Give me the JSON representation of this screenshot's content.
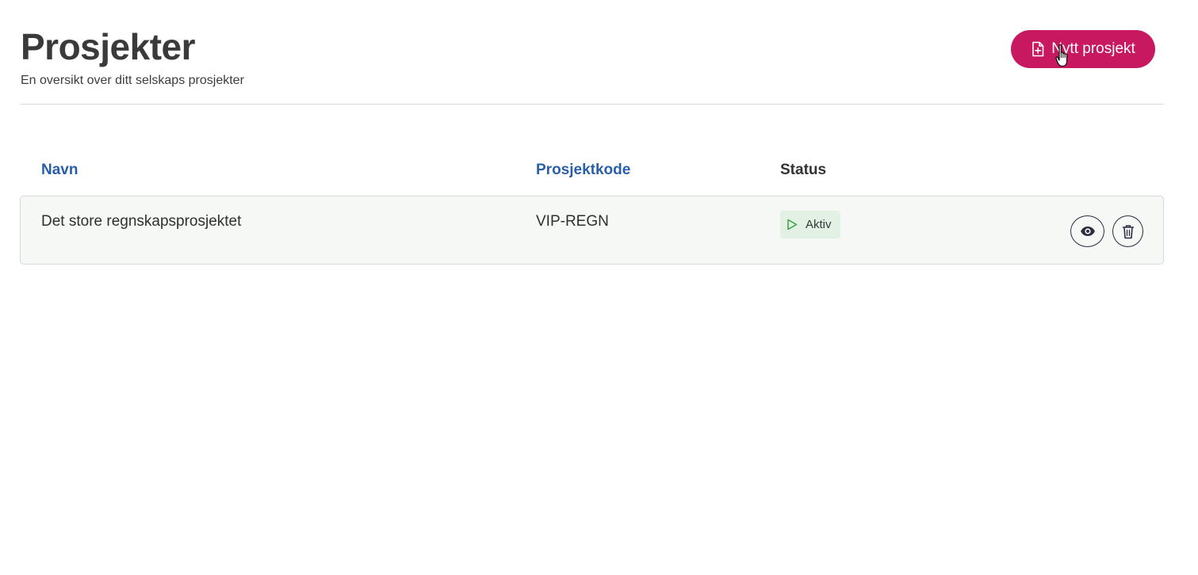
{
  "header": {
    "title": "Prosjekter",
    "subtitle": "En oversikt over ditt selskaps prosjekter",
    "new_button_label": "Nytt prosjekt"
  },
  "table": {
    "columns": [
      {
        "label": "Navn",
        "sortable": true
      },
      {
        "label": "Prosjektkode",
        "sortable": true
      },
      {
        "label": "Status",
        "sortable": false
      }
    ],
    "rows": [
      {
        "name": "Det store regnskapsprosjektet",
        "code": "VIP-REGN",
        "status": "Aktiv",
        "actions": [
          "eye-icon",
          "trash-icon"
        ]
      }
    ]
  },
  "colors": {
    "primary_button": "#c8185f",
    "link": "#2a5fa8",
    "status_active_bg": "#e2f1e4",
    "status_active_icon": "#3aa04a"
  },
  "icons": {
    "new_button": "file-plus-icon",
    "status": "play-icon",
    "cursor": "hand-pointer-icon"
  }
}
